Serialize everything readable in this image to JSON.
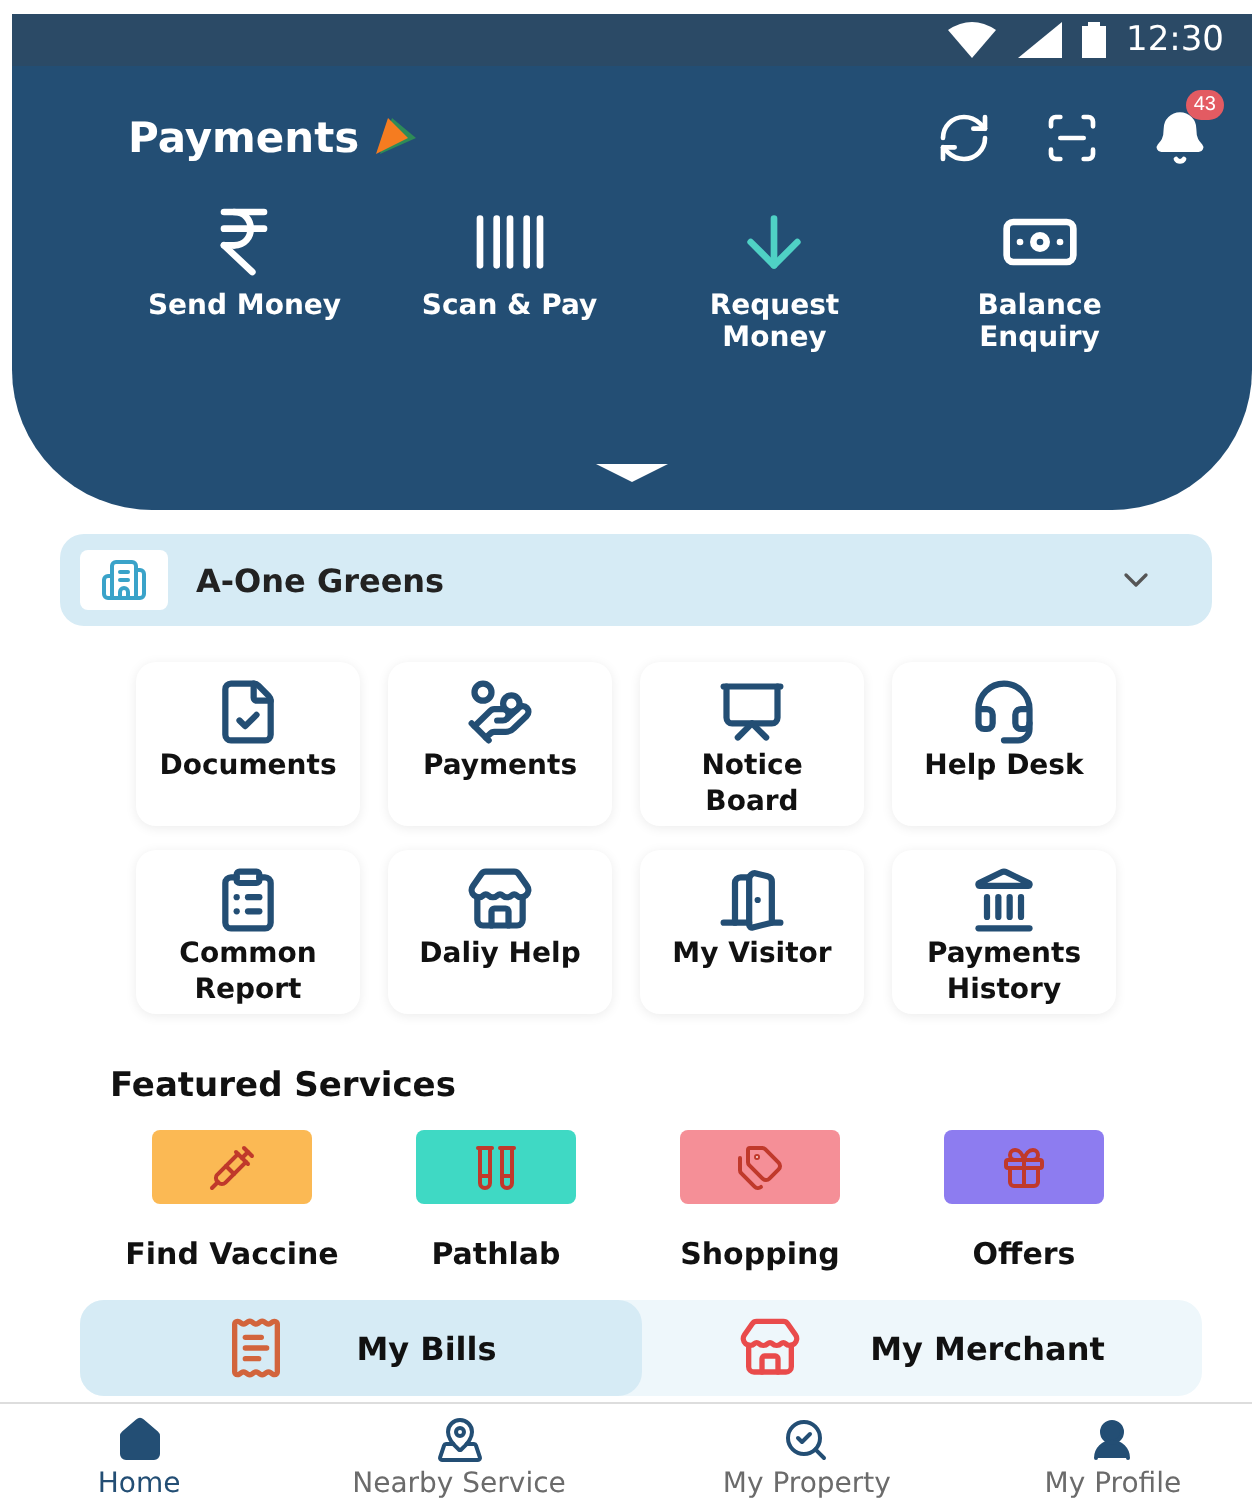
{
  "status_bar": {
    "time": "12:30"
  },
  "header": {
    "title": "Payments",
    "notification_count": "43",
    "actions": [
      {
        "label": "Send Money"
      },
      {
        "label": "Scan & Pay"
      },
      {
        "label": "Request Money"
      },
      {
        "label": "Balance Enquiry"
      }
    ]
  },
  "property": {
    "name": "A-One Greens"
  },
  "services": [
    {
      "label": "Documents"
    },
    {
      "label": "Payments"
    },
    {
      "label": "Notice Board"
    },
    {
      "label": "Help Desk"
    },
    {
      "label": "Common Report"
    },
    {
      "label": "Daliy Help"
    },
    {
      "label": "My Visitor"
    },
    {
      "label": "Payments History"
    }
  ],
  "featured": {
    "title": "Featured Services",
    "items": [
      {
        "label": "Find Vaccine",
        "color": "#fbb954"
      },
      {
        "label": "Pathlab",
        "color": "#3fd9c4"
      },
      {
        "label": "Shopping",
        "color": "#f58f97"
      },
      {
        "label": "Offers",
        "color": "#8d7cf0"
      }
    ]
  },
  "tabs": [
    {
      "label": "My Bills",
      "selected": true
    },
    {
      "label": "My Merchant",
      "selected": false
    }
  ],
  "bottom_nav": [
    {
      "label": "Home",
      "selected": true
    },
    {
      "label": "Nearby Service",
      "selected": false
    },
    {
      "label": "My Property",
      "selected": false
    },
    {
      "label": "My Profile",
      "selected": false
    }
  ]
}
